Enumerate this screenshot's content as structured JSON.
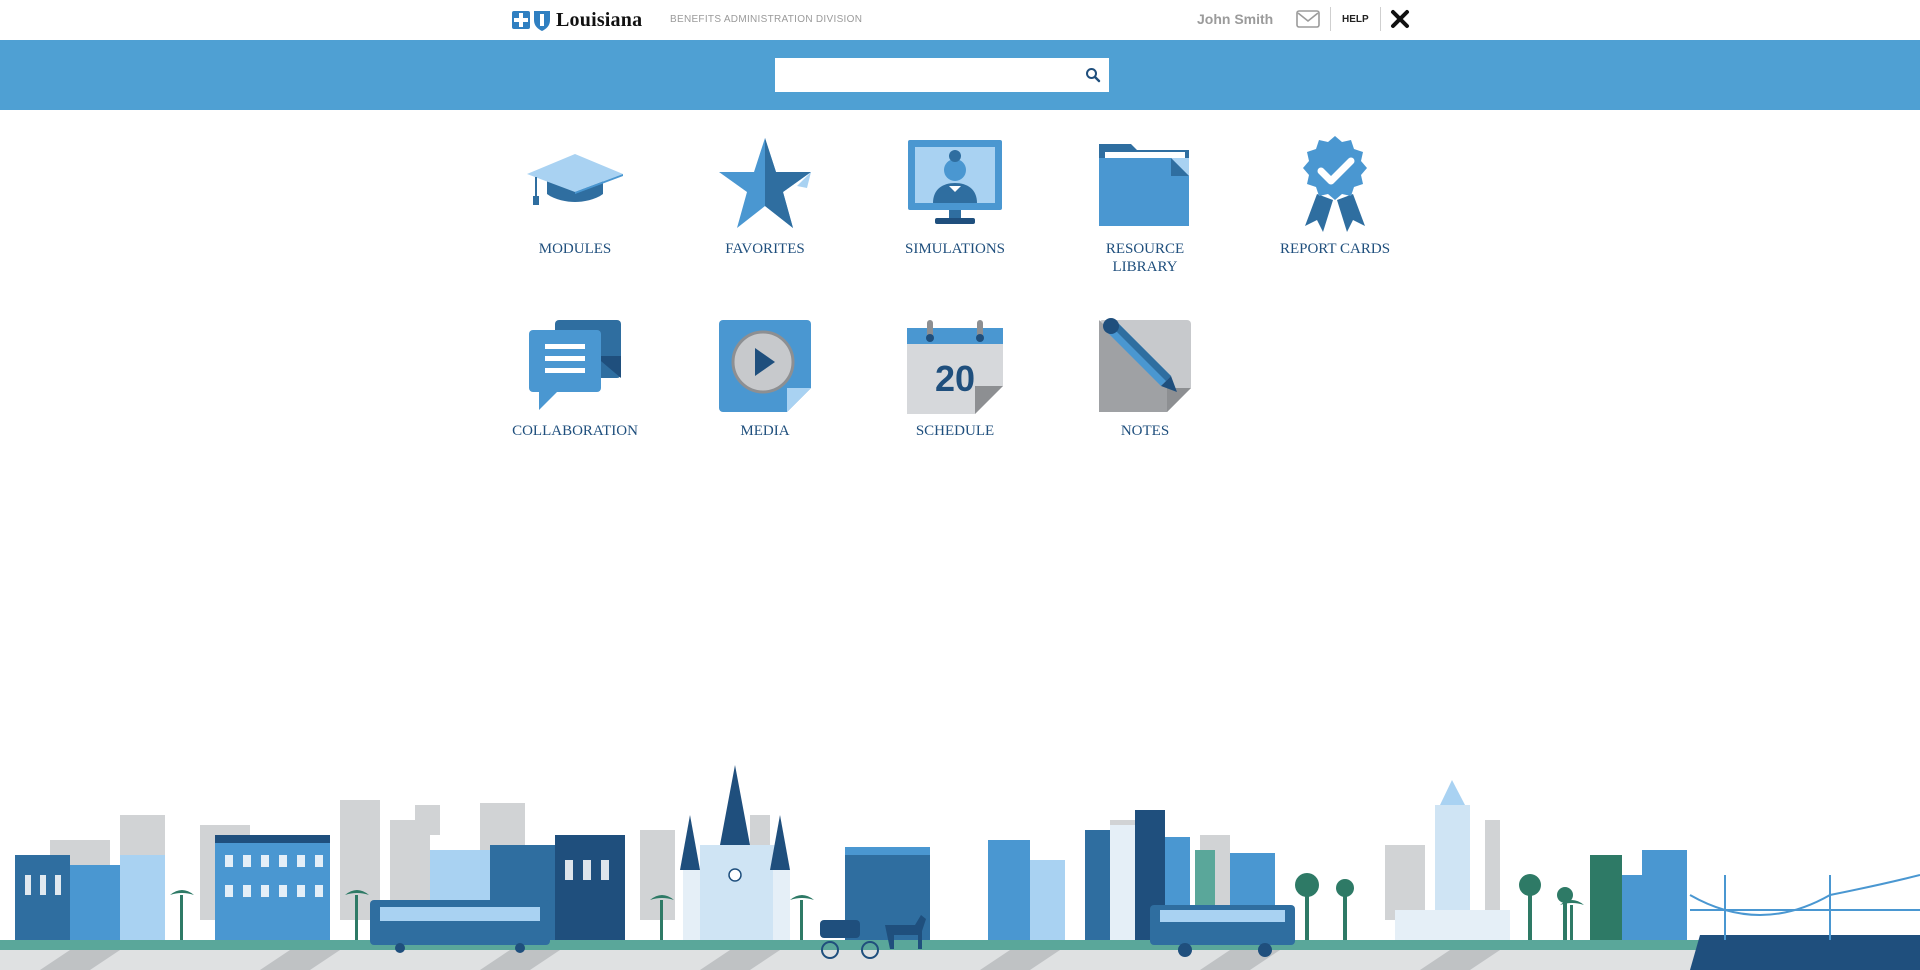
{
  "header": {
    "brand_name": "Louisiana",
    "division": "BENEFITS ADMINISTRATION DIVISION",
    "user_name": "John Smith",
    "help_label": "HELP",
    "icons": [
      "blue-cross-logo",
      "mail-icon",
      "close-icon"
    ]
  },
  "search": {
    "placeholder": "",
    "icon": "search-icon"
  },
  "tiles": [
    {
      "label": "MODULES",
      "icon": "graduation-cap-icon"
    },
    {
      "label": "FAVORITES",
      "icon": "star-icon"
    },
    {
      "label": "SIMULATIONS",
      "icon": "monitor-person-icon"
    },
    {
      "label": "RESOURCE LIBRARY",
      "icon": "folder-icon"
    },
    {
      "label": "REPORT CARDS",
      "icon": "award-badge-icon"
    },
    {
      "label": "COLLABORATION",
      "icon": "chat-bubble-icon"
    },
    {
      "label": "MEDIA",
      "icon": "play-media-icon"
    },
    {
      "label": "SCHEDULE",
      "icon": "calendar-icon",
      "calendar_day": "20"
    },
    {
      "label": "NOTES",
      "icon": "pencil-note-icon"
    }
  ],
  "colors": {
    "band_blue": "#4fa0d3",
    "label_navy": "#1f4f7d",
    "icon_blue": "#4a97d1",
    "icon_dark": "#2f6ea0",
    "icon_light": "#a9d2f2"
  },
  "footer": {
    "illustration": "new-orleans-skyline-illustration"
  }
}
